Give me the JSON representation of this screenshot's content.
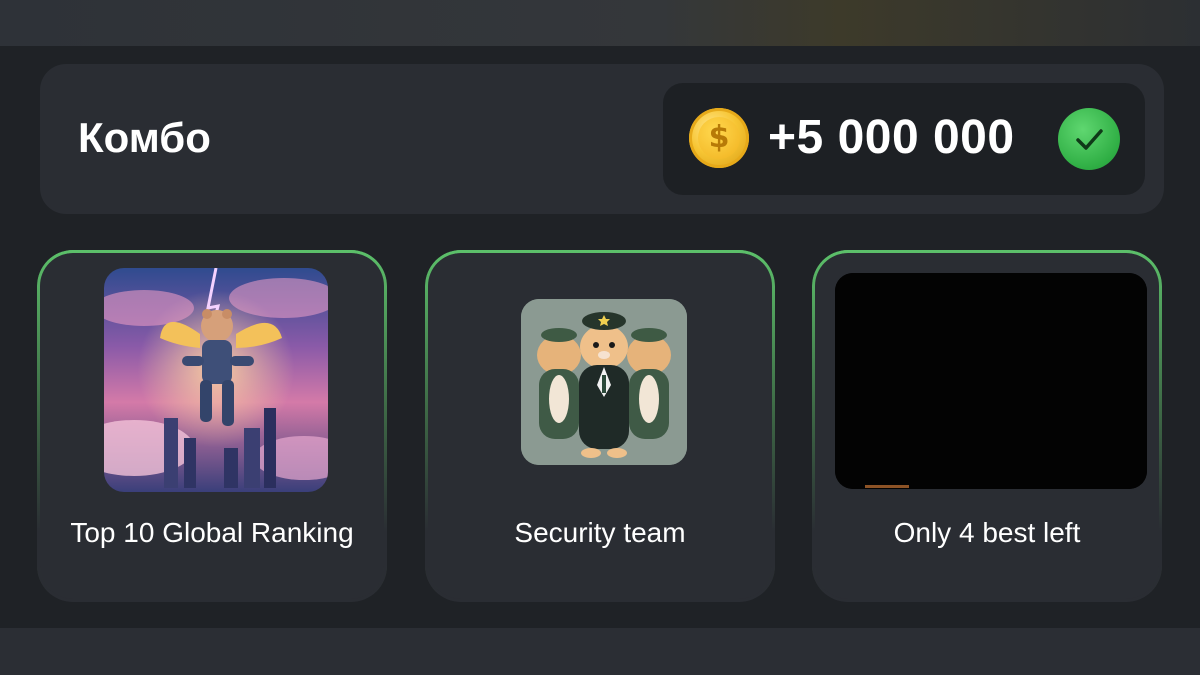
{
  "combo": {
    "title": "Комбо",
    "reward": "+5 000 000",
    "coin_icon": "dollar-coin-icon",
    "coin_symbol": "$",
    "status_icon": "checkmark-icon"
  },
  "cards": [
    {
      "label": "Top 10 Global Ranking",
      "image": "hamster-astronaut-wings-city-illustration"
    },
    {
      "label": "Security team",
      "image": "three-hamsters-in-uniform-illustration"
    },
    {
      "label": "Only 4 best left",
      "image": "dark-image"
    }
  ],
  "colors": {
    "accent_green": "#58b863",
    "coin_gold": "#f7c634",
    "panel_bg": "#1f2226",
    "card_bg": "#2a2d33"
  }
}
